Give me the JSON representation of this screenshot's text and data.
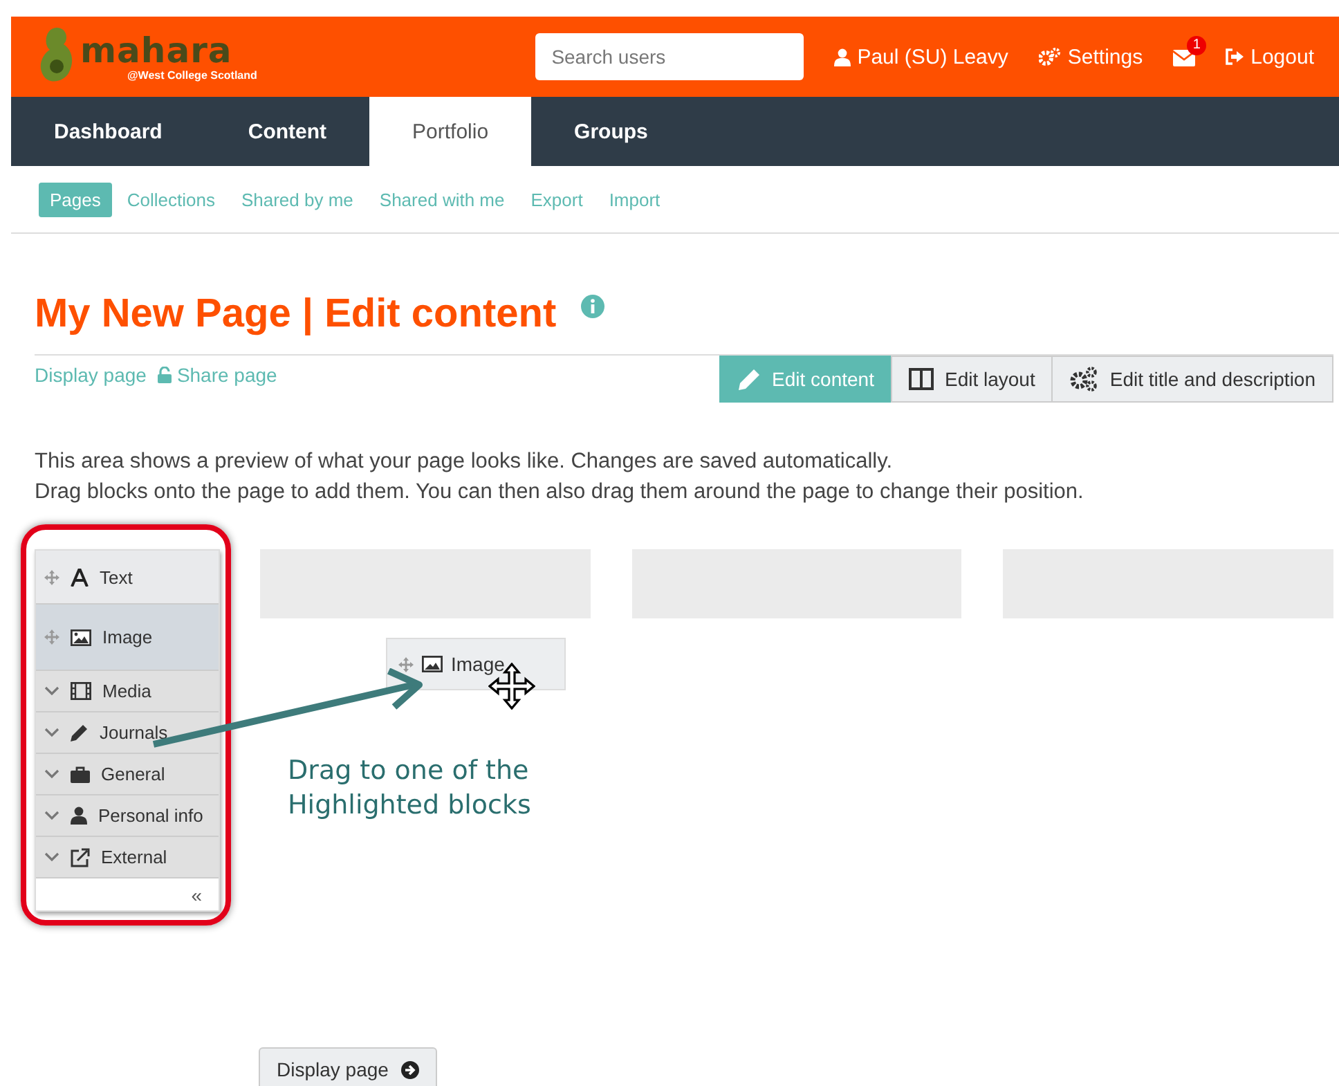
{
  "header": {
    "logo": {
      "name": "mahara",
      "subtitle": "@West College Scotland"
    },
    "search": {
      "placeholder": "Search users"
    },
    "user": "Paul (SU) Leavy",
    "settings": "Settings",
    "messages": {
      "badge": "1"
    },
    "logout": "Logout"
  },
  "nav_tabs": [
    {
      "label": "Dashboard",
      "selected": false
    },
    {
      "label": "Content",
      "selected": false
    },
    {
      "label": "Portfolio",
      "selected": true
    },
    {
      "label": "Groups",
      "selected": false
    }
  ],
  "sub_tabs": [
    {
      "label": "Pages",
      "selected": true
    },
    {
      "label": "Collections",
      "selected": false
    },
    {
      "label": "Shared by me",
      "selected": false
    },
    {
      "label": "Shared with me",
      "selected": false
    },
    {
      "label": "Export",
      "selected": false
    },
    {
      "label": "Import",
      "selected": false
    }
  ],
  "title": "My New Page | Edit content",
  "page_links": [
    {
      "label": "Display page",
      "kind": "plain"
    },
    {
      "label": "Share page",
      "kind": "lock"
    }
  ],
  "edit_tabs": [
    {
      "label": "Edit content",
      "kind": "pencil",
      "selected": true
    },
    {
      "label": "Edit layout",
      "kind": "layout",
      "selected": false
    },
    {
      "label": "Edit title and description",
      "kind": "gears",
      "selected": false
    }
  ],
  "intro": [
    "This area shows a preview of what your page looks like. Changes are saved automatically.",
    "Drag blocks onto the page to add them. You can then also drag them around the page to change their position."
  ],
  "palette": {
    "items": [
      {
        "kind": "block",
        "label": "Text",
        "selected": false
      },
      {
        "kind": "block",
        "label": "Image",
        "selected": true
      },
      {
        "kind": "category",
        "label": "Media"
      },
      {
        "kind": "category",
        "label": "Journals"
      },
      {
        "kind": "category",
        "label": "General"
      },
      {
        "kind": "category",
        "label": "Personal info"
      },
      {
        "kind": "category",
        "label": "External"
      }
    ],
    "collapse": "«"
  },
  "dragged_block": {
    "label": "Image"
  },
  "annotation": [
    "Drag to one of the",
    "Highlighted blocks"
  ],
  "footer_button": "Display page"
}
